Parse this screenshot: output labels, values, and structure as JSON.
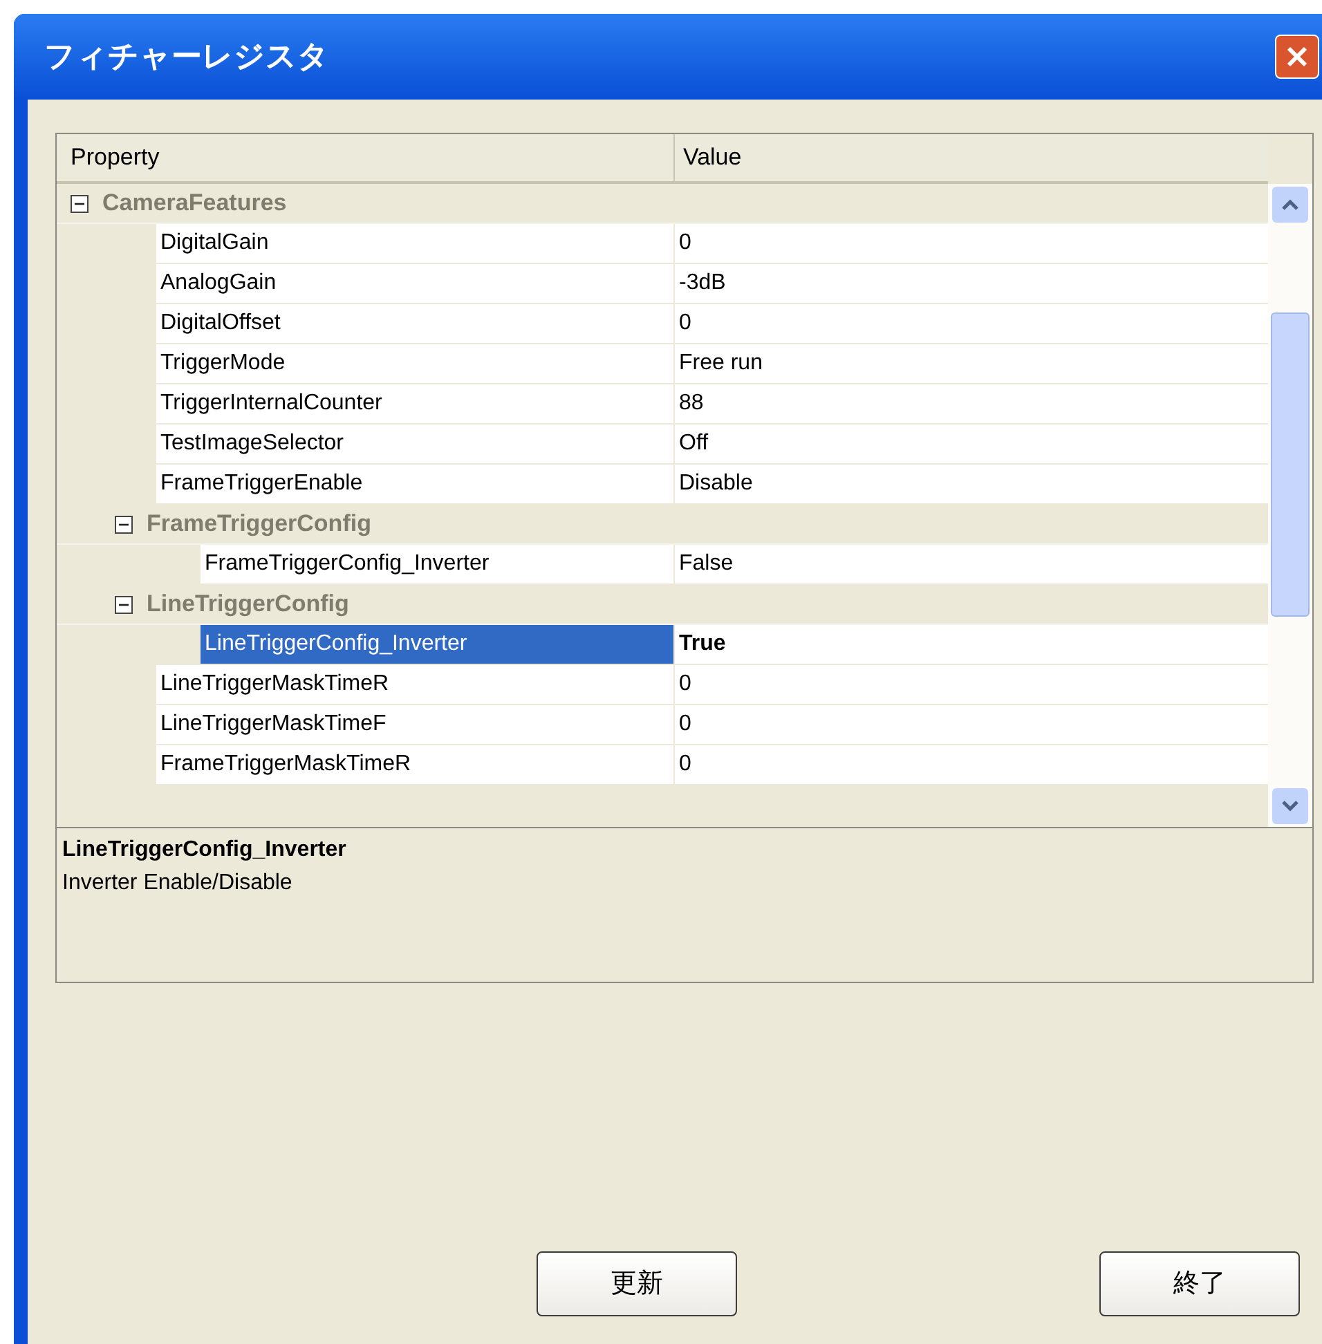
{
  "window": {
    "title": "フィチャーレジスタ"
  },
  "grid": {
    "columns": [
      "Property",
      "Value"
    ],
    "rows": [
      {
        "kind": "category",
        "name": "CameraFeatures",
        "expanded": true,
        "children": [
          {
            "kind": "property",
            "name": "DigitalGain",
            "value": "0",
            "selected": false
          },
          {
            "kind": "property",
            "name": "AnalogGain",
            "value": "-3dB",
            "selected": false
          },
          {
            "kind": "property",
            "name": "DigitalOffset",
            "value": "0",
            "selected": false
          },
          {
            "kind": "property",
            "name": "TriggerMode",
            "value": "Free run",
            "selected": false
          },
          {
            "kind": "property",
            "name": "TriggerInternalCounter",
            "value": "88",
            "selected": false
          },
          {
            "kind": "property",
            "name": "TestImageSelector",
            "value": "Off",
            "selected": false
          },
          {
            "kind": "property",
            "name": "FrameTriggerEnable",
            "value": "Disable",
            "selected": false
          },
          {
            "kind": "category",
            "name": "FrameTriggerConfig",
            "expanded": true,
            "children": [
              {
                "kind": "property",
                "name": "FrameTriggerConfig_Inverter",
                "value": "False",
                "selected": false
              }
            ]
          },
          {
            "kind": "category",
            "name": "LineTriggerConfig",
            "expanded": true,
            "children": [
              {
                "kind": "property",
                "name": "LineTriggerConfig_Inverter",
                "value": "True",
                "selected": true
              }
            ]
          },
          {
            "kind": "property",
            "name": "LineTriggerMaskTimeR",
            "value": "0",
            "selected": false
          },
          {
            "kind": "property",
            "name": "LineTriggerMaskTimeF",
            "value": "0",
            "selected": false
          },
          {
            "kind": "property",
            "name": "FrameTriggerMaskTimeR",
            "value": "0",
            "selected": false
          }
        ]
      }
    ]
  },
  "description": {
    "title": "LineTriggerConfig_Inverter",
    "text": "Inverter Enable/Disable"
  },
  "buttons": [
    "更新",
    "終了"
  ]
}
